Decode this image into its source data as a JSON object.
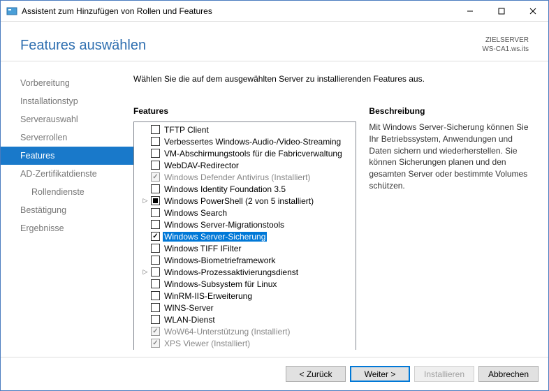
{
  "titlebar": {
    "title": "Assistent zum Hinzufügen von Rollen und Features"
  },
  "header": {
    "page_title": "Features auswählen",
    "target_label": "ZIELSERVER",
    "target_value": "WS-CA1.ws.its"
  },
  "sidebar": {
    "items": [
      {
        "id": "vorbereitung",
        "label": "Vorbereitung",
        "active": false,
        "sub": false
      },
      {
        "id": "installationstyp",
        "label": "Installationstyp",
        "active": false,
        "sub": false
      },
      {
        "id": "serverauswahl",
        "label": "Serverauswahl",
        "active": false,
        "sub": false
      },
      {
        "id": "serverrollen",
        "label": "Serverrollen",
        "active": false,
        "sub": false
      },
      {
        "id": "features",
        "label": "Features",
        "active": true,
        "sub": false
      },
      {
        "id": "ad-zertifikatdienste",
        "label": "AD-Zertifikatdienste",
        "active": false,
        "sub": false
      },
      {
        "id": "rollendienste",
        "label": "Rollendienste",
        "active": false,
        "sub": true
      },
      {
        "id": "bestaetigung",
        "label": "Bestätigung",
        "active": false,
        "sub": false
      },
      {
        "id": "ergebnisse",
        "label": "Ergebnisse",
        "active": false,
        "sub": false
      }
    ]
  },
  "main": {
    "instruction": "Wählen Sie die auf dem ausgewählten Server zu installierenden Features aus.",
    "features_heading": "Features",
    "description_heading": "Beschreibung",
    "description_text": "Mit Windows Server-Sicherung können Sie Ihr Betriebssystem, Anwendungen und Daten sichern und wiederherstellen. Sie können Sicherungen planen und den gesamten Server oder bestimmte Volumes schützen.",
    "features": [
      {
        "label": "TFTP Client",
        "state": "unchecked",
        "expand": "",
        "disabled": false,
        "selected": false
      },
      {
        "label": "Verbessertes Windows-Audio-/Video-Streaming",
        "state": "unchecked",
        "expand": "",
        "disabled": false,
        "selected": false
      },
      {
        "label": "VM-Abschirmungstools für die Fabricverwaltung",
        "state": "unchecked",
        "expand": "",
        "disabled": false,
        "selected": false
      },
      {
        "label": "WebDAV-Redirector",
        "state": "unchecked",
        "expand": "",
        "disabled": false,
        "selected": false
      },
      {
        "label": "Windows Defender Antivirus (Installiert)",
        "state": "checked",
        "expand": "",
        "disabled": true,
        "selected": false
      },
      {
        "label": "Windows Identity Foundation 3.5",
        "state": "unchecked",
        "expand": "",
        "disabled": false,
        "selected": false
      },
      {
        "label": "Windows PowerShell (2 von 5 installiert)",
        "state": "partial",
        "expand": "▷",
        "disabled": false,
        "selected": false
      },
      {
        "label": "Windows Search",
        "state": "unchecked",
        "expand": "",
        "disabled": false,
        "selected": false
      },
      {
        "label": "Windows Server-Migrationstools",
        "state": "unchecked",
        "expand": "",
        "disabled": false,
        "selected": false
      },
      {
        "label": "Windows Server-Sicherung",
        "state": "checked",
        "expand": "",
        "disabled": false,
        "selected": true
      },
      {
        "label": "Windows TIFF IFilter",
        "state": "unchecked",
        "expand": "",
        "disabled": false,
        "selected": false
      },
      {
        "label": "Windows-Biometrieframework",
        "state": "unchecked",
        "expand": "",
        "disabled": false,
        "selected": false
      },
      {
        "label": "Windows-Prozessaktivierungsdienst",
        "state": "unchecked",
        "expand": "▷",
        "disabled": false,
        "selected": false
      },
      {
        "label": "Windows-Subsystem für Linux",
        "state": "unchecked",
        "expand": "",
        "disabled": false,
        "selected": false
      },
      {
        "label": "WinRM-IIS-Erweiterung",
        "state": "unchecked",
        "expand": "",
        "disabled": false,
        "selected": false
      },
      {
        "label": "WINS-Server",
        "state": "unchecked",
        "expand": "",
        "disabled": false,
        "selected": false
      },
      {
        "label": "WLAN-Dienst",
        "state": "unchecked",
        "expand": "",
        "disabled": false,
        "selected": false
      },
      {
        "label": "WoW64-Unterstützung (Installiert)",
        "state": "checked",
        "expand": "",
        "disabled": true,
        "selected": false
      },
      {
        "label": "XPS Viewer (Installiert)",
        "state": "checked",
        "expand": "",
        "disabled": true,
        "selected": false
      }
    ]
  },
  "footer": {
    "back": "< Zurück",
    "next": "Weiter >",
    "install": "Installieren",
    "cancel": "Abbrechen"
  }
}
